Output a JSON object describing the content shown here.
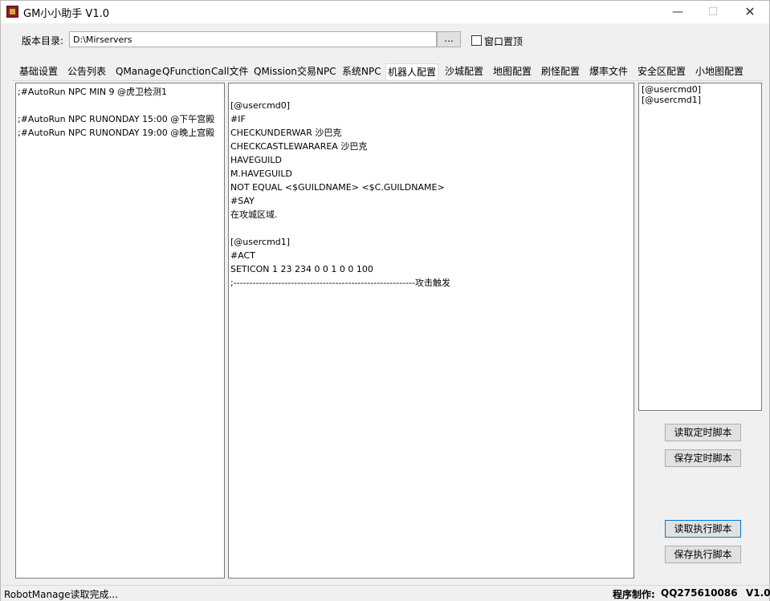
{
  "window": {
    "title": "GM小小助手 V1.0",
    "min_glyph": "—",
    "max_glyph": "☐",
    "close_glyph": "✕"
  },
  "directory": {
    "label": "版本目录:",
    "value": "D:\\Mirservers",
    "browse_label": "...",
    "topmost_label": "窗口置顶"
  },
  "tabs": [
    "基础设置",
    "公告列表",
    "QManage",
    "QFunction",
    "Call文件",
    "QMission",
    "交易NPC",
    "系统NPC",
    "机器人配置",
    "沙城配置",
    "地图配置",
    "刷怪配置",
    "爆率文件",
    "安全区配置",
    "小地图配置"
  ],
  "active_tab": "机器人配置",
  "left_panel_lines": [
    ";#AutoRun NPC MIN 9 @虎卫检测1",
    "",
    ";#AutoRun NPC RUNONDAY 15:00 @下午宫殿",
    ";#AutoRun NPC RUNONDAY 19:00 @晚上宫殿"
  ],
  "center_panel_lines": [
    "[@usercmd0]",
    "#IF",
    "CHECKUNDERWAR 沙巴克",
    "CHECKCASTLEWARAREA 沙巴克",
    "HAVEGUILD",
    "M.HAVEGUILD",
    "NOT EQUAL <$GUILDNAME> <$C.GUILDNAME>",
    "#SAY",
    "在攻城区域.",
    "",
    "[@usercmd1]",
    "#ACT",
    "SETICON 1 23 234 0 0 1 0 0 100",
    ";---------------------------------------------------------攻击触发"
  ],
  "right_panel_items": [
    "[@usercmd0]",
    "[@usercmd1]"
  ],
  "buttons": {
    "read_timer": "读取定时脚本",
    "save_timer": "保存定时脚本",
    "read_exec": "读取执行脚本",
    "save_exec": "保存执行脚本"
  },
  "status": {
    "left": "RobotManage读取完成...",
    "author_label": "程序制作:",
    "author": "QQ275610086",
    "version": "V1.0"
  }
}
